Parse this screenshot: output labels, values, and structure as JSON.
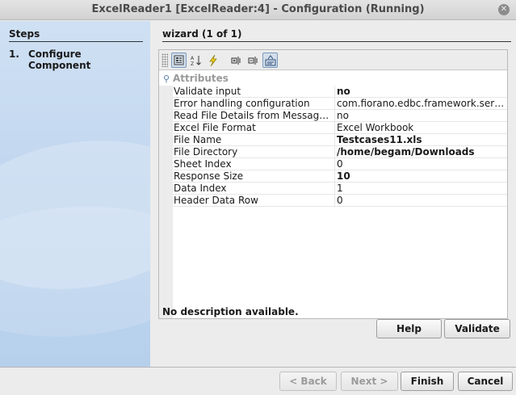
{
  "window": {
    "title": "ExcelReader1 [ExcelReader:4] - Configuration (Running)",
    "close_glyph": "✕"
  },
  "steps": {
    "heading": "Steps",
    "items": [
      {
        "number": "1.",
        "label": "Configure Component"
      }
    ]
  },
  "wizard": {
    "title": "wizard (1 of 1)"
  },
  "toolbar": {
    "icons": [
      "categorized-view-icon",
      "sort-alphabetical-icon",
      "lightning-icon",
      "expand-all-icon",
      "collapse-all-icon",
      "toggle-description-icon"
    ]
  },
  "properties": {
    "section": "Attributes",
    "rows": [
      {
        "key": "Validate input",
        "value": "no",
        "bold": true
      },
      {
        "key": "Error handling configuration",
        "value": "com.fiorano.edbc.framework.servi...",
        "bold": false
      },
      {
        "key": "Read File Details from Message...",
        "value": "no",
        "bold": false
      },
      {
        "key": "Excel File Format",
        "value": "Excel Workbook",
        "bold": false
      },
      {
        "key": "File Name",
        "value": "Testcases11.xls",
        "bold": true
      },
      {
        "key": "File Directory",
        "value": "/home/begam/Downloads",
        "bold": true
      },
      {
        "key": "Sheet Index",
        "value": "0",
        "bold": false
      },
      {
        "key": "Response Size",
        "value": "10",
        "bold": true
      },
      {
        "key": "Data Index",
        "value": "1",
        "bold": false
      },
      {
        "key": "Header Data Row",
        "value": "0",
        "bold": false
      }
    ]
  },
  "description": "No description available.",
  "buttons": {
    "help": "Help",
    "validate": "Validate",
    "back": "< Back",
    "next": "Next >",
    "finish": "Finish",
    "cancel": "Cancel"
  }
}
